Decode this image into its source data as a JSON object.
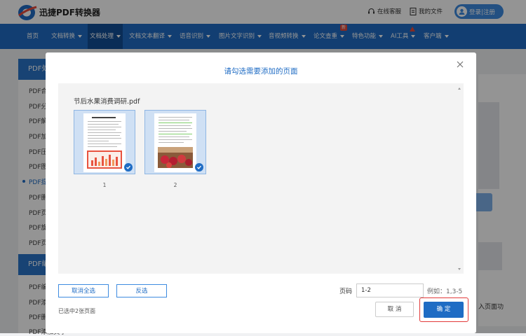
{
  "header": {
    "logo_text": "迅捷PDF转换器",
    "service": "在线客服",
    "my_files": "我的文件",
    "login": "登录|注册"
  },
  "nav": {
    "items": [
      {
        "label": "首页"
      },
      {
        "label": "文档转换"
      },
      {
        "label": "文档处理"
      },
      {
        "label": "文档文本翻译"
      },
      {
        "label": "语音识别"
      },
      {
        "label": "图片文字识别"
      },
      {
        "label": "音视频转换"
      },
      {
        "label": "论文查重"
      },
      {
        "label": "特色功能"
      },
      {
        "label": "AI工具"
      },
      {
        "label": "客户端"
      }
    ],
    "new_badge": "新"
  },
  "sidebar": {
    "head1": "PDF处",
    "head2": "PDF编",
    "items": [
      "PDF合",
      "PDF分",
      "PDF解",
      "PDF加",
      "PDF压",
      "PDF图",
      "PDF提",
      "PDF删",
      "PDF页",
      "PDF旋",
      "PDF页",
      "PDF编",
      "PDF添",
      "PDF删"
    ],
    "last_line": "PDF添加文字"
  },
  "background": {
    "right_text": "入页面功"
  },
  "modal": {
    "title": "请勾选需要添加的页面",
    "file_name": "节后水果消费调研.pdf",
    "pages": [
      {
        "number": "1",
        "selected": true
      },
      {
        "number": "2",
        "selected": true
      }
    ],
    "deselect_all": "取消全选",
    "invert_select": "反选",
    "selected_info": "已选中2张页面",
    "page_label": "页码",
    "page_input_value": "1-2",
    "example": "例如：1,3-5",
    "cancel": "取 消",
    "confirm": "确 定"
  },
  "colors": {
    "brand_blue": "#1f6cc4",
    "highlight_red": "#e23a3a"
  }
}
